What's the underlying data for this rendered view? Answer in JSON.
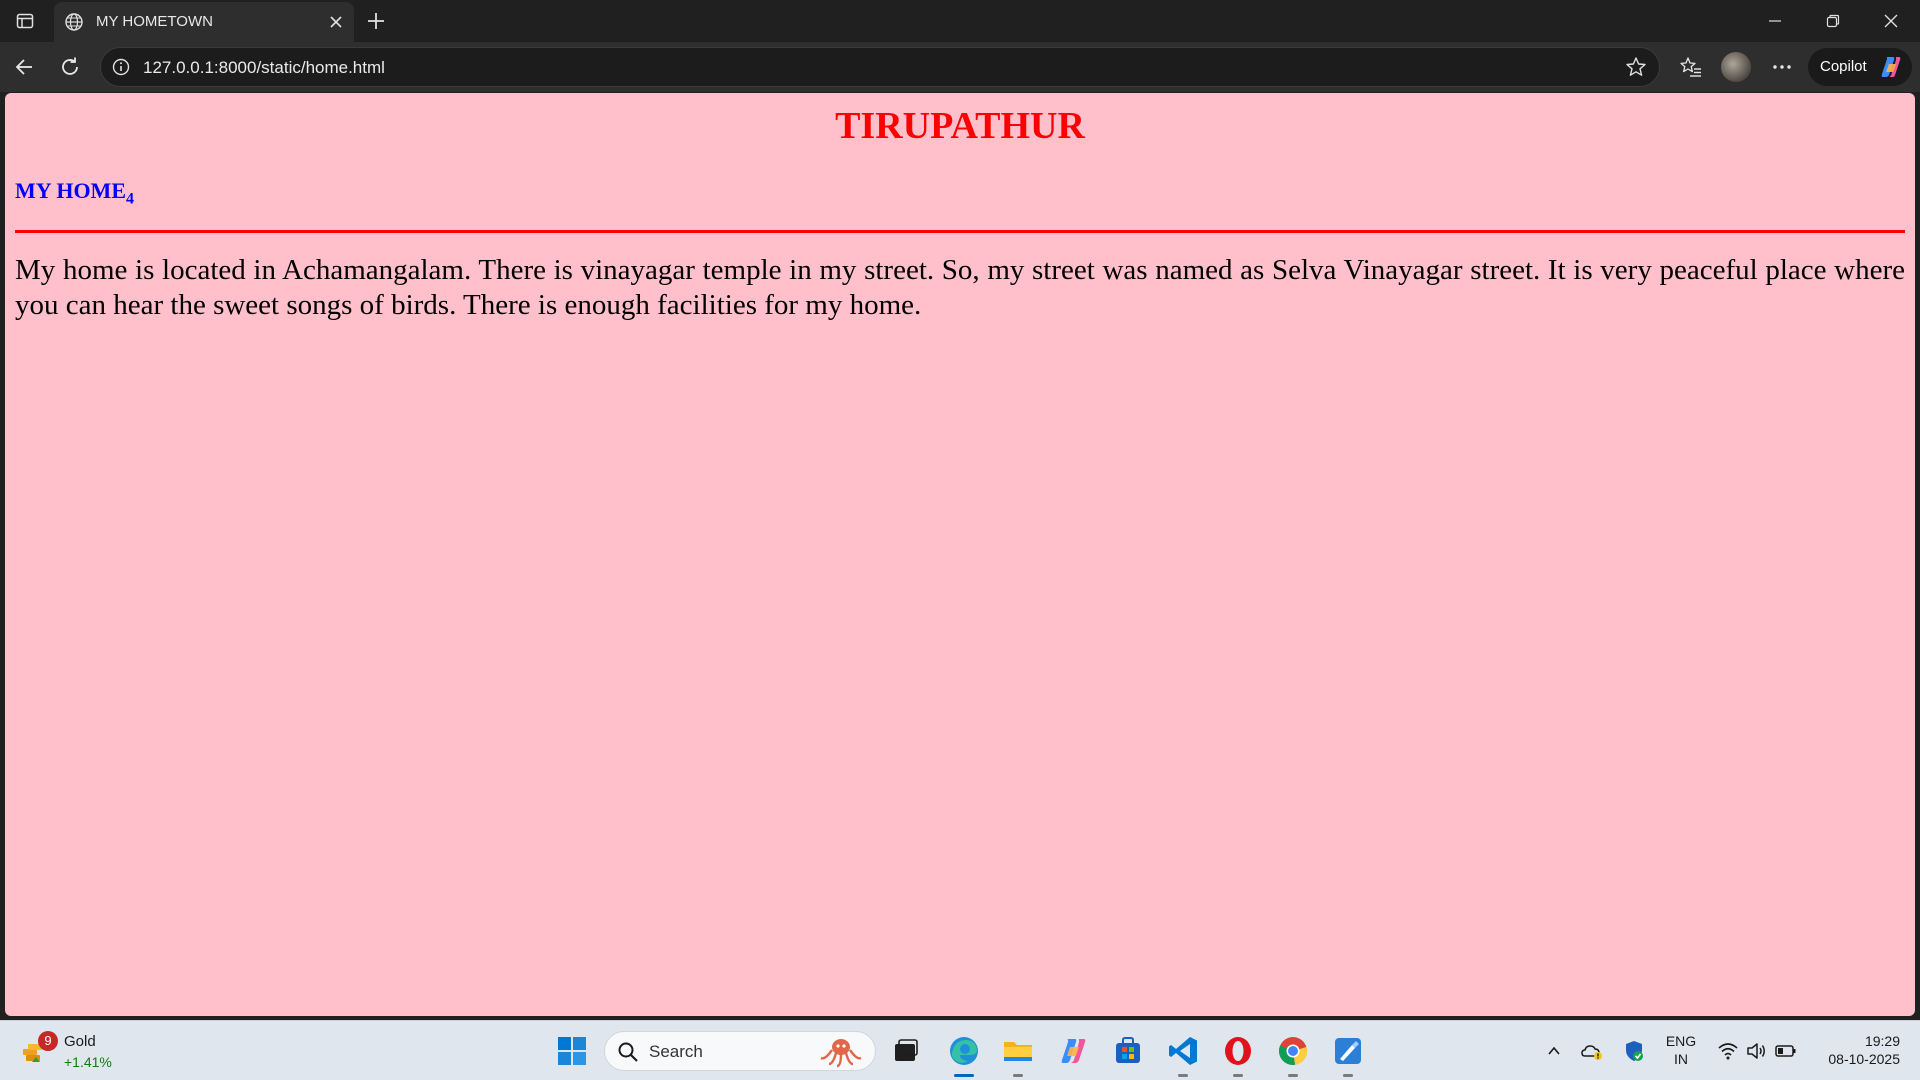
{
  "browser": {
    "tab": {
      "title": "MY HOMETOWN"
    },
    "address_bar": {
      "url": "127.0.0.1:8000/static/home.html"
    },
    "copilot_label": "Copilot"
  },
  "page": {
    "heading": "TIRUPATHUR",
    "subheading": "MY HOME",
    "subheading_subscript": "4",
    "paragraph": "My home is located in Achamangalam. There is vinayagar temple in my street. So, my street was named as Selva Vinayagar street. It is very peaceful place where you can hear the sweet songs of birds. There is enough facilities for my home.",
    "colors": {
      "background": "#ffc0cb",
      "heading": "#ff0000",
      "subheading": "#0000ff",
      "rule": "#ff0000"
    }
  },
  "taskbar": {
    "widget": {
      "badge": "9",
      "title": "Gold",
      "value": "+1.41%"
    },
    "search_placeholder": "Search",
    "apps": [
      "task-view",
      "edge",
      "file-explorer",
      "copilot",
      "microsoft-store",
      "vs-code",
      "opera",
      "chrome",
      "paint"
    ],
    "tray": {
      "language": "ENG",
      "region": "IN",
      "time": "19:29",
      "date": "08-10-2025"
    }
  }
}
